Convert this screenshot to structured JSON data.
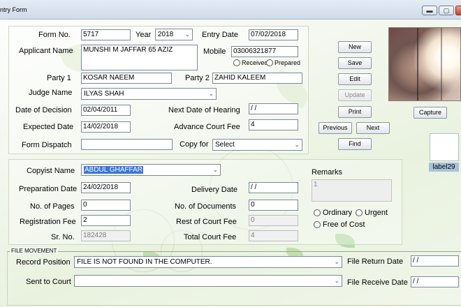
{
  "window": {
    "title": "ntry Form",
    "minimize": "▬",
    "maximize": "▢",
    "close": "✕"
  },
  "form": {
    "form_no_label": "Form No.",
    "form_no": "5717",
    "year_label": "Year",
    "year": "2018",
    "entry_date_label": "Entry Date",
    "entry_date": "07/02/2018",
    "applicant_label": "Applicant Name",
    "applicant": "MUNSHI M JAFFAR 65 AZIZ",
    "mobile_label": "Mobile",
    "mobile": "03006321877",
    "received_label": "Received",
    "prepared_label": "Prepared",
    "party1_label": "Party 1",
    "party1": "KOSAR NAEEM",
    "party2_label": "Party 2",
    "party2": "ZAHID KALEEM",
    "judge_label": "Judge Name",
    "judge": "ILYAS SHAH",
    "decision_label": "Date of Decision",
    "decision": "02/04/2011",
    "next_hearing_label": "Next Date of Hearing",
    "next_hearing": " / /",
    "expected_label": "Expected Date",
    "expected": "14/02/2018",
    "advance_fee_label": "Advance Court Fee",
    "advance_fee": "4",
    "dispatch_label": "Form Dispatch",
    "dispatch": "",
    "copy_for_label": "Copy for",
    "copy_for": "Select"
  },
  "copy": {
    "copyist_label": "Copyist Name",
    "copyist": "ABDUL GHAFFAR",
    "remarks_label": "Remarks",
    "remarks": "1",
    "prep_date_label": "Preparation Date",
    "prep_date": "24/02/2018",
    "delivery_label": "Delivery Date",
    "delivery": " / /",
    "pages_label": "No. of Pages",
    "pages": "0",
    "docs_label": "No. of Documents",
    "docs": "0",
    "ordinary_label": "Ordinary",
    "urgent_label": "Urgent",
    "reg_fee_label": "Registration Fee",
    "reg_fee": "2",
    "rest_fee_label": "Rest of Court Fee",
    "rest_fee": "0",
    "free_label": "Free of Cost",
    "sr_label": "Sr. No.",
    "sr": "182428",
    "total_fee_label": "Total Court Fee",
    "total_fee": "4"
  },
  "movement": {
    "legend": "FILE MOVEMENT",
    "record_label": "Record Position",
    "record": "FILE IS NOT FOUND IN THE COMPUTER.",
    "return_label": "File Return Date",
    "return_date": " / /",
    "sent_label": "Sent to Court",
    "sent": "",
    "receive_label": "File Receive Date",
    "receive_date": " / /"
  },
  "buttons": {
    "new": "New",
    "save": "Save",
    "edit": "Edit",
    "update": "Update",
    "print": "Print",
    "previous": "Previous",
    "next": "Next",
    "find": "Find",
    "capture": "Capture"
  },
  "label29": "label29",
  "icons": {
    "dropdown": "chevron-down-icon",
    "radio": "radio-button-icon"
  },
  "colors": {
    "selection": "#3875d7",
    "label29_bg": "#a8c2da"
  }
}
